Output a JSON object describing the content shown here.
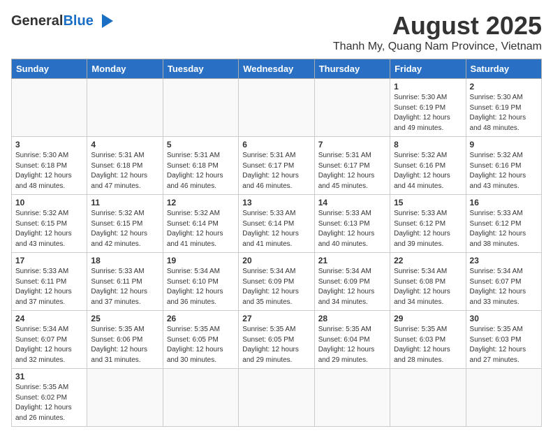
{
  "header": {
    "logo_general": "General",
    "logo_blue": "Blue",
    "title": "August 2025",
    "subtitle": "Thanh My, Quang Nam Province, Vietnam"
  },
  "weekdays": [
    "Sunday",
    "Monday",
    "Tuesday",
    "Wednesday",
    "Thursday",
    "Friday",
    "Saturday"
  ],
  "weeks": [
    [
      {
        "day": "",
        "info": ""
      },
      {
        "day": "",
        "info": ""
      },
      {
        "day": "",
        "info": ""
      },
      {
        "day": "",
        "info": ""
      },
      {
        "day": "",
        "info": ""
      },
      {
        "day": "1",
        "info": "Sunrise: 5:30 AM\nSunset: 6:19 PM\nDaylight: 12 hours\nand 49 minutes."
      },
      {
        "day": "2",
        "info": "Sunrise: 5:30 AM\nSunset: 6:19 PM\nDaylight: 12 hours\nand 48 minutes."
      }
    ],
    [
      {
        "day": "3",
        "info": "Sunrise: 5:30 AM\nSunset: 6:18 PM\nDaylight: 12 hours\nand 48 minutes."
      },
      {
        "day": "4",
        "info": "Sunrise: 5:31 AM\nSunset: 6:18 PM\nDaylight: 12 hours\nand 47 minutes."
      },
      {
        "day": "5",
        "info": "Sunrise: 5:31 AM\nSunset: 6:18 PM\nDaylight: 12 hours\nand 46 minutes."
      },
      {
        "day": "6",
        "info": "Sunrise: 5:31 AM\nSunset: 6:17 PM\nDaylight: 12 hours\nand 46 minutes."
      },
      {
        "day": "7",
        "info": "Sunrise: 5:31 AM\nSunset: 6:17 PM\nDaylight: 12 hours\nand 45 minutes."
      },
      {
        "day": "8",
        "info": "Sunrise: 5:32 AM\nSunset: 6:16 PM\nDaylight: 12 hours\nand 44 minutes."
      },
      {
        "day": "9",
        "info": "Sunrise: 5:32 AM\nSunset: 6:16 PM\nDaylight: 12 hours\nand 43 minutes."
      }
    ],
    [
      {
        "day": "10",
        "info": "Sunrise: 5:32 AM\nSunset: 6:15 PM\nDaylight: 12 hours\nand 43 minutes."
      },
      {
        "day": "11",
        "info": "Sunrise: 5:32 AM\nSunset: 6:15 PM\nDaylight: 12 hours\nand 42 minutes."
      },
      {
        "day": "12",
        "info": "Sunrise: 5:32 AM\nSunset: 6:14 PM\nDaylight: 12 hours\nand 41 minutes."
      },
      {
        "day": "13",
        "info": "Sunrise: 5:33 AM\nSunset: 6:14 PM\nDaylight: 12 hours\nand 41 minutes."
      },
      {
        "day": "14",
        "info": "Sunrise: 5:33 AM\nSunset: 6:13 PM\nDaylight: 12 hours\nand 40 minutes."
      },
      {
        "day": "15",
        "info": "Sunrise: 5:33 AM\nSunset: 6:12 PM\nDaylight: 12 hours\nand 39 minutes."
      },
      {
        "day": "16",
        "info": "Sunrise: 5:33 AM\nSunset: 6:12 PM\nDaylight: 12 hours\nand 38 minutes."
      }
    ],
    [
      {
        "day": "17",
        "info": "Sunrise: 5:33 AM\nSunset: 6:11 PM\nDaylight: 12 hours\nand 37 minutes."
      },
      {
        "day": "18",
        "info": "Sunrise: 5:33 AM\nSunset: 6:11 PM\nDaylight: 12 hours\nand 37 minutes."
      },
      {
        "day": "19",
        "info": "Sunrise: 5:34 AM\nSunset: 6:10 PM\nDaylight: 12 hours\nand 36 minutes."
      },
      {
        "day": "20",
        "info": "Sunrise: 5:34 AM\nSunset: 6:09 PM\nDaylight: 12 hours\nand 35 minutes."
      },
      {
        "day": "21",
        "info": "Sunrise: 5:34 AM\nSunset: 6:09 PM\nDaylight: 12 hours\nand 34 minutes."
      },
      {
        "day": "22",
        "info": "Sunrise: 5:34 AM\nSunset: 6:08 PM\nDaylight: 12 hours\nand 34 minutes."
      },
      {
        "day": "23",
        "info": "Sunrise: 5:34 AM\nSunset: 6:07 PM\nDaylight: 12 hours\nand 33 minutes."
      }
    ],
    [
      {
        "day": "24",
        "info": "Sunrise: 5:34 AM\nSunset: 6:07 PM\nDaylight: 12 hours\nand 32 minutes."
      },
      {
        "day": "25",
        "info": "Sunrise: 5:35 AM\nSunset: 6:06 PM\nDaylight: 12 hours\nand 31 minutes."
      },
      {
        "day": "26",
        "info": "Sunrise: 5:35 AM\nSunset: 6:05 PM\nDaylight: 12 hours\nand 30 minutes."
      },
      {
        "day": "27",
        "info": "Sunrise: 5:35 AM\nSunset: 6:05 PM\nDaylight: 12 hours\nand 29 minutes."
      },
      {
        "day": "28",
        "info": "Sunrise: 5:35 AM\nSunset: 6:04 PM\nDaylight: 12 hours\nand 29 minutes."
      },
      {
        "day": "29",
        "info": "Sunrise: 5:35 AM\nSunset: 6:03 PM\nDaylight: 12 hours\nand 28 minutes."
      },
      {
        "day": "30",
        "info": "Sunrise: 5:35 AM\nSunset: 6:03 PM\nDaylight: 12 hours\nand 27 minutes."
      }
    ],
    [
      {
        "day": "31",
        "info": "Sunrise: 5:35 AM\nSunset: 6:02 PM\nDaylight: 12 hours\nand 26 minutes."
      },
      {
        "day": "",
        "info": ""
      },
      {
        "day": "",
        "info": ""
      },
      {
        "day": "",
        "info": ""
      },
      {
        "day": "",
        "info": ""
      },
      {
        "day": "",
        "info": ""
      },
      {
        "day": "",
        "info": ""
      }
    ]
  ]
}
